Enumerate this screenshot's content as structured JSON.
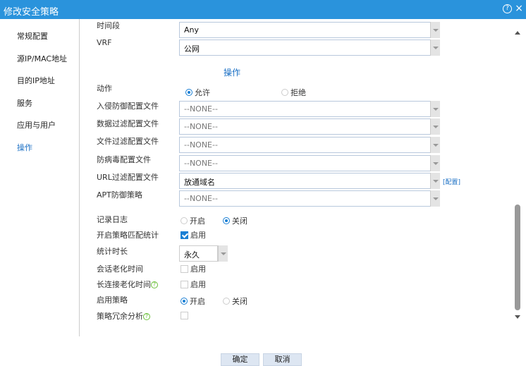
{
  "title": "修改安全策略",
  "help_icon": "?",
  "close_icon": "×",
  "sidebar": [
    {
      "label": "常规配置"
    },
    {
      "label": "源IP/MAC地址"
    },
    {
      "label": "目的IP地址"
    },
    {
      "label": "服务"
    },
    {
      "label": "应用与用户"
    },
    {
      "label": "操作"
    }
  ],
  "fields": {
    "time_label": "时间段",
    "time_value": "Any",
    "vrf_label": "VRF",
    "vrf_value": "公网",
    "section_heading": "操作",
    "action_label": "动作",
    "action_allow": "允许",
    "action_deny": "拒绝",
    "ips_label": "入侵防御配置文件",
    "ips_value": "--NONE--",
    "data_filter_label": "数据过滤配置文件",
    "data_filter_value": "--NONE--",
    "file_filter_label": "文件过滤配置文件",
    "file_filter_value": "--NONE--",
    "av_label": "防病毒配置文件",
    "av_value": "--NONE--",
    "url_label": "URL过滤配置文件",
    "url_value": "放通域名",
    "url_config_link": "[配置]",
    "apt_label": "APT防御策略",
    "apt_value": "--NONE--",
    "log_label": "记录日志",
    "log_on": "开启",
    "log_off": "关闭",
    "stats_label": "开启策略匹配统计",
    "stats_enable": "启用",
    "duration_label": "统计时长",
    "duration_value": "永久",
    "session_age_label": "会话老化时间",
    "session_age_enable": "启用",
    "long_conn_label": "长连接老化时间",
    "long_conn_enable": "启用",
    "enable_policy_label": "启用策略",
    "enable_on": "开启",
    "enable_off": "关闭",
    "redundancy_label": "策略冗余分析"
  },
  "footer": {
    "ok": "确定",
    "cancel": "取消"
  }
}
